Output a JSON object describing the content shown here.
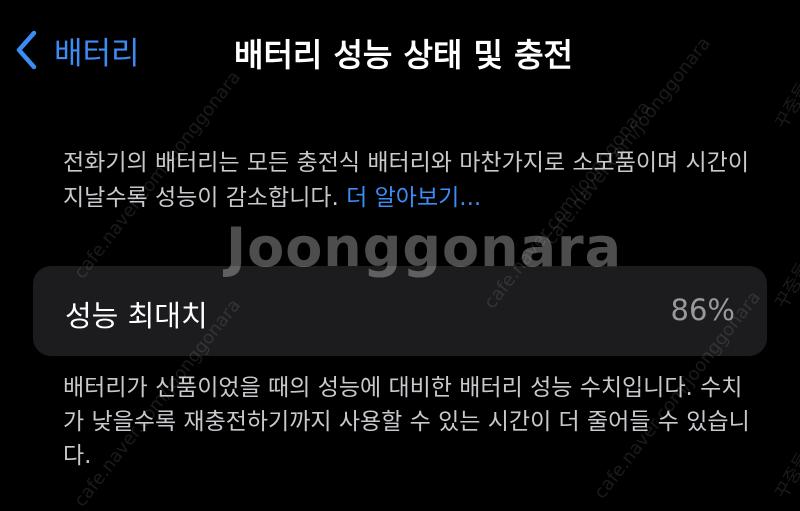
{
  "nav": {
    "back_label": "배터리",
    "title": "배터리 성능 상태 및 충전"
  },
  "intro": {
    "text": "전화기의 배터리는 모든 충전식 배터리와 마찬가지로 소모품이며 시간이 지날수록 성능이 감소합니다.",
    "link": "더 알아보기..."
  },
  "max_capacity": {
    "label": "성능 최대치",
    "value": "86%"
  },
  "footer": {
    "text": "배터리가 신품이었을 때의 성능에 대비한 배터리 성능 수치입니다. 수치가 낮을수록 재충전하기까지 사용할 수 있는 시간이 더 줄어들 수 있습니다."
  },
  "watermark": {
    "logo": "Joonggonara",
    "url": "cafe.naver.com/joonggonara",
    "side": "꾸중들"
  },
  "colors": {
    "background": "#000000",
    "accent": "#3b8cf5",
    "card": "#1c1c1e",
    "secondary_text": "#98989d"
  }
}
